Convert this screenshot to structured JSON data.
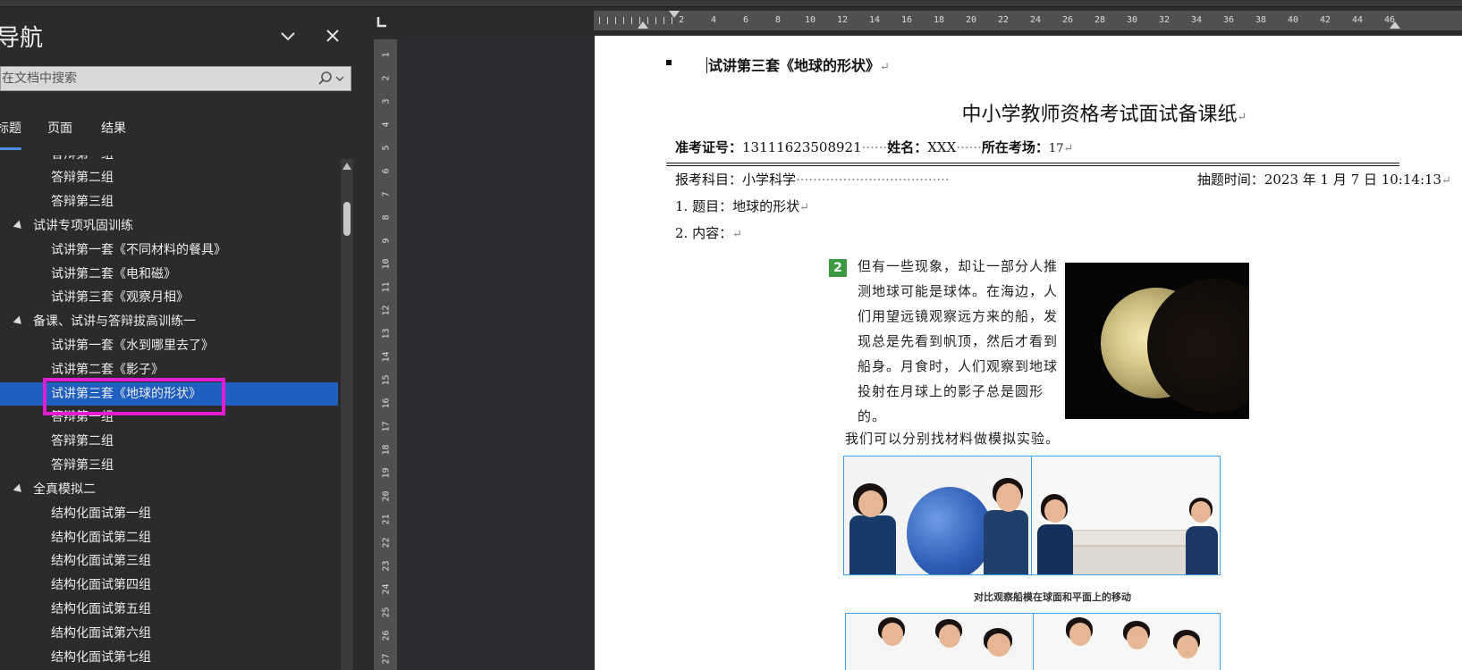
{
  "nav": {
    "title": "导航",
    "search_placeholder": "在文档中搜索",
    "tabs": [
      {
        "label": "标题",
        "active": true
      },
      {
        "label": "页面",
        "active": false
      },
      {
        "label": "结果",
        "active": false
      }
    ],
    "items": [
      {
        "label": "答辩第一组",
        "level": 2
      },
      {
        "label": "答辩第二组",
        "level": 2
      },
      {
        "label": "答辩第三组",
        "level": 2
      },
      {
        "label": "试讲专项巩固训练",
        "level": 1
      },
      {
        "label": "试讲第一套《不同材料的餐具》",
        "level": 2
      },
      {
        "label": "试讲第二套《电和磁》",
        "level": 2
      },
      {
        "label": "试讲第三套《观察月相》",
        "level": 2
      },
      {
        "label": "备课、试讲与答辩拔高训练一",
        "level": 1
      },
      {
        "label": "试讲第一套《水到哪里去了》",
        "level": 2
      },
      {
        "label": "试讲第二套《影子》",
        "level": 2
      },
      {
        "label": "试讲第三套《地球的形状》",
        "level": 2,
        "selected": true
      },
      {
        "label": "答辩第一组",
        "level": 2
      },
      {
        "label": "答辩第二组",
        "level": 2
      },
      {
        "label": "答辩第三组",
        "level": 2
      },
      {
        "label": "全真模拟二",
        "level": 1
      },
      {
        "label": "结构化面试第一组",
        "level": 2
      },
      {
        "label": "结构化面试第二组",
        "level": 2
      },
      {
        "label": "结构化面试第三组",
        "level": 2
      },
      {
        "label": "结构化面试第四组",
        "level": 2
      },
      {
        "label": "结构化面试第五组",
        "level": 2
      },
      {
        "label": "结构化面试第六组",
        "level": 2
      },
      {
        "label": "结构化面试第七组",
        "level": 2
      }
    ]
  },
  "ruler": {
    "h_labels": [
      "2",
      "4",
      "6",
      "8",
      "10",
      "12",
      "14",
      "16",
      "18",
      "20",
      "22",
      "24",
      "26",
      "28",
      "30",
      "32",
      "34",
      "36",
      "38",
      "40",
      "42",
      "44",
      "46"
    ],
    "v_labels": [
      "1",
      "2",
      "3",
      "4",
      "5",
      "6",
      "7",
      "8",
      "9",
      "10",
      "11",
      "12",
      "13",
      "14",
      "15",
      "16",
      "17",
      "18",
      "19",
      "20",
      "21",
      "22",
      "23",
      "24",
      "25",
      "26",
      "27"
    ]
  },
  "doc": {
    "heading": "试讲第三套《地球的形状》",
    "paragraph_mark": "↵",
    "title": "中小学教师资格考试面试备课纸",
    "exam_no_label": "准考证号：",
    "exam_no": "13111623508921",
    "name_label": "姓名：",
    "name": "XXX",
    "site_label": "所在考场：",
    "site": "17",
    "subject_label": "报考科目：",
    "subject": "小学科学",
    "draw_time_label": "抽题时间：",
    "draw_time": "2023 年 1 月 7 日 10:14:13",
    "topic": "1. 题目：地球的形状",
    "content": "2. 内容：",
    "textbook": {
      "number": "2",
      "paragraph": "但有一些现象，却让一部分人推测地球可能是球体。在海边，人们用望远镜观察远方来的船，发现总是先看到帆顶，然后才看到船身。月食时，人们观察到地球投射在月球上的影子总是圆形的。",
      "line2": "我们可以分别找材料做模拟实验。",
      "caption": "对比观察船模在球面和平面上的移动"
    }
  }
}
